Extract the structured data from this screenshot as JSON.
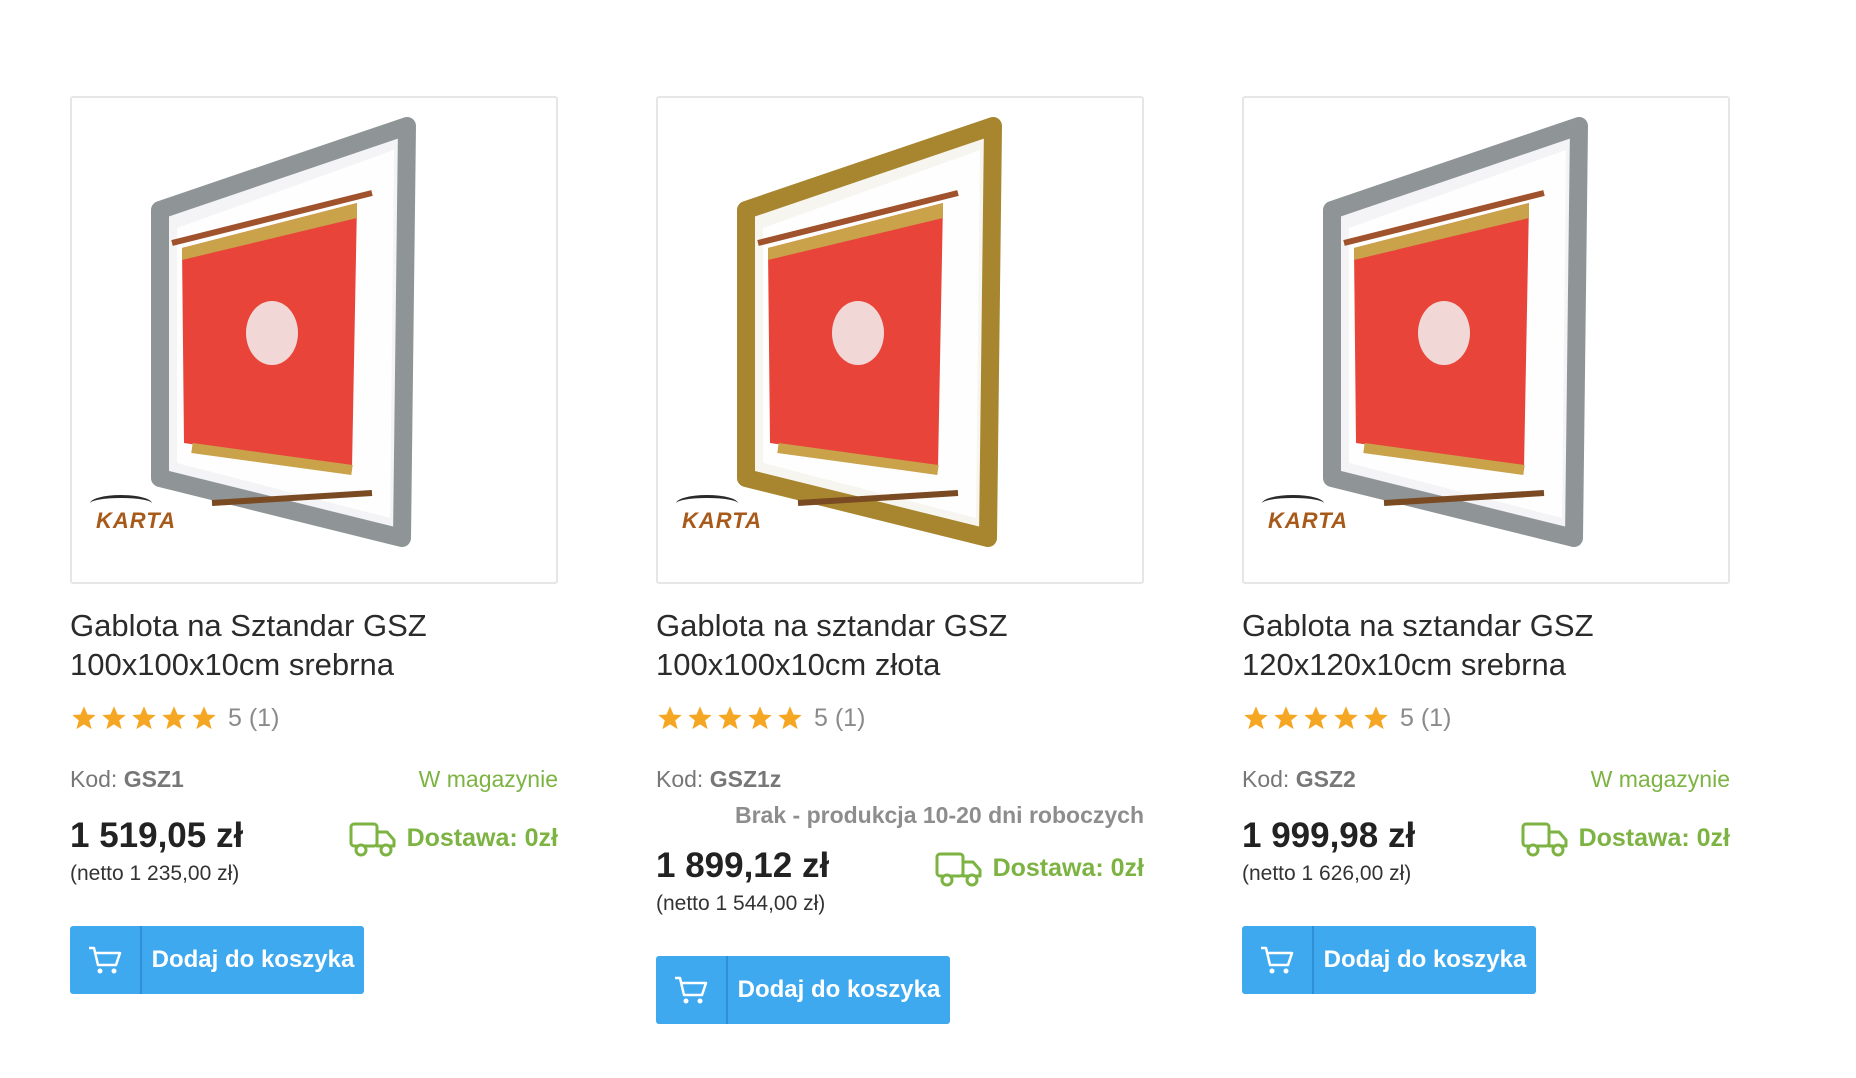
{
  "products": [
    {
      "title_line1": "Gablota na Sztandar GSZ",
      "title_line2": "100x100x10cm srebrna",
      "frame_color": "#8f9597",
      "rating_text": "5 (1)",
      "kod_label": "Kod:",
      "kod_value": "GSZ1",
      "stock": "W magazynie",
      "availability_note": "",
      "price": "1 519,05 zł",
      "netto": "(netto 1 235,00 zł)",
      "delivery": "Dostawa: 0zł",
      "button_label": "Dodaj do koszyka",
      "logo": "KARTA"
    },
    {
      "title_line1": "Gablota na sztandar GSZ",
      "title_line2": "100x100x10cm złota",
      "frame_color": "#a7862f",
      "rating_text": "5 (1)",
      "kod_label": "Kod:",
      "kod_value": "GSZ1z",
      "stock": "",
      "availability_note": "Brak - produkcja 10-20 dni roboczych",
      "price": "1 899,12 zł",
      "netto": "(netto 1 544,00 zł)",
      "delivery": "Dostawa: 0zł",
      "button_label": "Dodaj do koszyka",
      "logo": "KARTA"
    },
    {
      "title_line1": "Gablota na sztandar GSZ",
      "title_line2": "120x120x10cm srebrna",
      "frame_color": "#8f9597",
      "rating_text": "5 (1)",
      "kod_label": "Kod:",
      "kod_value": "GSZ2",
      "stock": "W magazynie",
      "availability_note": "",
      "price": "1 999,98 zł",
      "netto": "(netto 1 626,00 zł)",
      "delivery": "Dostawa: 0zł",
      "button_label": "Dodaj do koszyka",
      "logo": "KARTA"
    }
  ],
  "icons": {
    "star": "star-icon",
    "delivery": "truck-icon",
    "cart": "cart-icon"
  },
  "colors": {
    "accent_button": "#3fa9f0",
    "stock_green": "#7cb342",
    "star_orange": "#f5a623",
    "flag_red": "#e8443a"
  }
}
